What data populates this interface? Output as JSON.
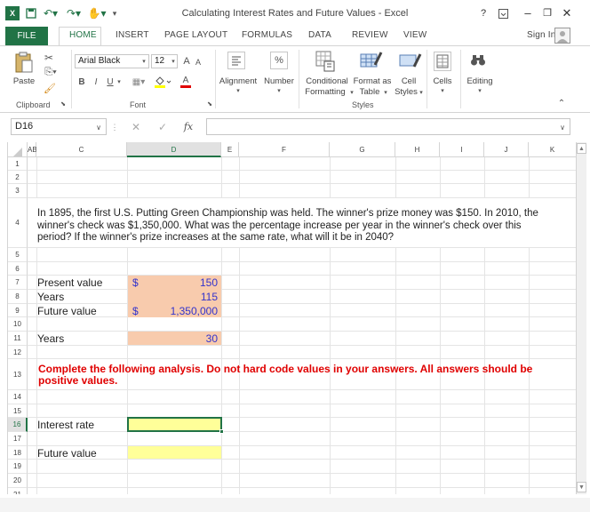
{
  "window": {
    "title": "Calculating Interest Rates and Future Values - Excel",
    "help_label": "?",
    "sign_in_label": "Sign In"
  },
  "ribbon_tabs": [
    "FILE",
    "HOME",
    "INSERT",
    "PAGE LAYOUT",
    "FORMULAS",
    "DATA",
    "REVIEW",
    "VIEW"
  ],
  "ribbon": {
    "paste_label": "Paste",
    "clipboard_label": "Clipboard",
    "font_name": "Arial Black",
    "font_size": "12",
    "font_group_label": "Font",
    "bold_label": "B",
    "italic_label": "I",
    "underline_label": "U",
    "alignment_label": "Alignment",
    "number_label": "Number",
    "number_icon": "%",
    "conditional_label_1": "Conditional",
    "conditional_label_2": "Formatting",
    "format_table_label_1": "Format as",
    "format_table_label_2": "Table",
    "cell_styles_label_1": "Cell",
    "cell_styles_label_2": "Styles",
    "styles_group_label": "Styles",
    "cells_label": "Cells",
    "editing_label": "Editing",
    "font_grow": "A",
    "font_shrink": "A",
    "font_color_letter": "A"
  },
  "formula_bar": {
    "name_box": "D16",
    "fx_label": "fx",
    "formula": ""
  },
  "columns": [
    "AB",
    "C",
    "D",
    "E",
    "F",
    "G",
    "H",
    "I",
    "J",
    "K"
  ],
  "rows": [
    "1",
    "2",
    "3",
    "4",
    "5",
    "6",
    "7",
    "8",
    "9",
    "10",
    "11",
    "12",
    "13",
    "14",
    "15",
    "16",
    "17",
    "18",
    "19",
    "20",
    "21"
  ],
  "sheet": {
    "question": "In 1895, the first U.S. Putting Green Championship was held. The winner's prize money was $150. In 2010, the winner's check was $1,350,000. What was the percentage increase per year in the winner's check over this period? If the winner's prize increases at the same rate, what will it be in 2040?",
    "present_value_label": "Present value",
    "present_value_currency": "$",
    "present_value": "150",
    "years_label": "Years",
    "years_value": "115",
    "future_value_label": "Future value",
    "future_value_currency": "$",
    "future_value": "1,350,000",
    "years2_label": "Years",
    "years2_value": "30",
    "instructions": "Complete the following analysis. Do not hard code values in your answers. All answers should be positive values.",
    "interest_rate_label": "Interest rate",
    "future_value2_label": "Future value"
  },
  "colors": {
    "excel_green": "#217346",
    "input_fill": "#f8cbad",
    "answer_fill": "#ffff99",
    "instruction_red": "#e00000",
    "value_blue": "#3333cc"
  }
}
